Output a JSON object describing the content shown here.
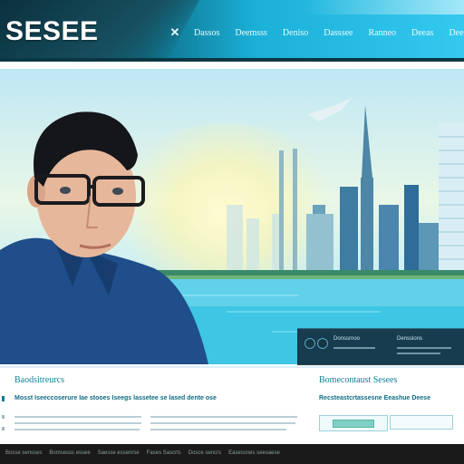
{
  "header": {
    "logo": "SESEE",
    "nav_icon": "close-icon",
    "nav_items": [
      "Dassos",
      "Deemsss",
      "Deniso",
      "Dasssee",
      "Ranneo",
      "Deeas",
      "Deenscs"
    ]
  },
  "hero": {
    "panel_links": [
      "Donssrnoo",
      "Densslons"
    ]
  },
  "content": {
    "left": {
      "title": "Baodsitreurcs",
      "subtitle": "Mosst Iseeccoserure Iae stooes  Iseegs lassetee se lased dente ose"
    },
    "right": {
      "title": "Bomecontaust Sesees",
      "subtitle": "Recsteastcrtassesne Eeashue Deese"
    }
  },
  "footer": {
    "links": [
      "Bosse sensses",
      "Bomsesss essee",
      "Saesse essenrse",
      "Fases Sascrts",
      "Dosce sencrs",
      "Easessnes seesaese"
    ]
  },
  "colors": {
    "header_dark": "#0b4a5e",
    "header_light": "#34c9ef",
    "accent": "#0f7e96",
    "footer_bg": "#1a1a1a"
  }
}
